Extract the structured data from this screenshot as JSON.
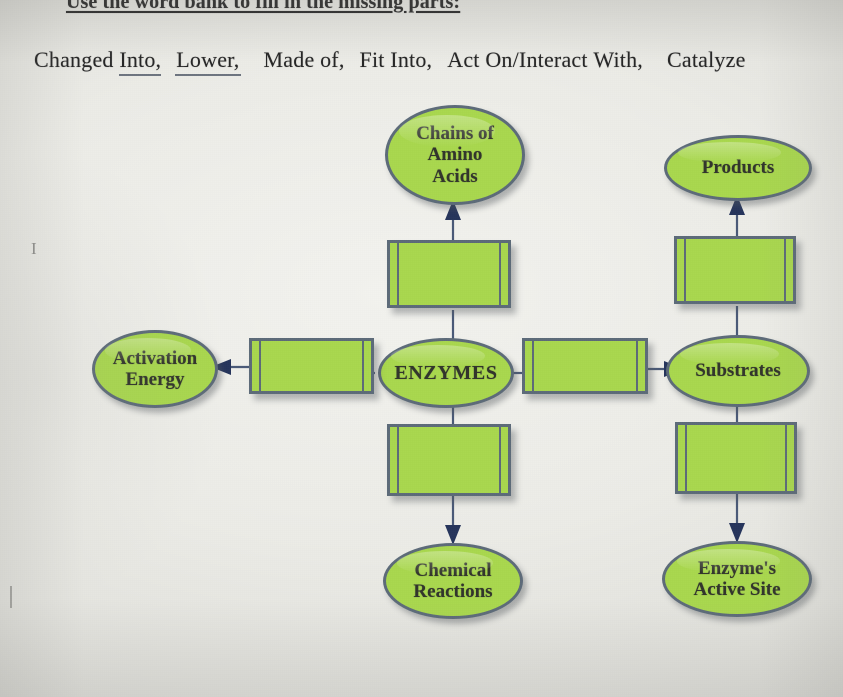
{
  "worksheet": {
    "instruction": "Use the word bank to fill in the missing parts:",
    "word_bank_label": "word bank",
    "words": [
      {
        "text": "Changed Into,",
        "underlined_part": "Into,"
      },
      {
        "text": "Lower,"
      },
      {
        "text": "Made of,"
      },
      {
        "text": "Fit Into,"
      },
      {
        "text": "Act On/Interact With,"
      },
      {
        "text": "Catalyze"
      }
    ],
    "word_bank_line": "Changed Into,  Lower,   Made of,   Fit Into,   Act On/Interact With,    Catalyze"
  },
  "diagram": {
    "type": "concept-map",
    "center": {
      "label": "ENZYMES"
    },
    "nodes": [
      {
        "id": "chains-of-amino-acids",
        "label": "Chains of\nAmino\nAcids",
        "lines": [
          "Chains of",
          "Amino",
          "Acids"
        ],
        "shape": "oval"
      },
      {
        "id": "products",
        "label": "Products",
        "lines": [
          "Products"
        ],
        "shape": "oval"
      },
      {
        "id": "activation-energy",
        "label": "Activation\nEnergy",
        "lines": [
          "Activation",
          "Energy"
        ],
        "shape": "oval"
      },
      {
        "id": "substrates",
        "label": "Substrates",
        "lines": [
          "Substrates"
        ],
        "shape": "oval"
      },
      {
        "id": "chemical-reactions",
        "label": "Chemical\nReactions",
        "lines": [
          "Chemical",
          "Reactions"
        ],
        "shape": "oval"
      },
      {
        "id": "enzymes-active-site",
        "label": "Enzyme's\nActive Site",
        "lines": [
          "Enzyme's",
          "Active Site"
        ],
        "shape": "oval"
      }
    ],
    "blanks": [
      {
        "id": "blank-top-center",
        "value": "",
        "connects": "ENZYMES -> Chains of Amino Acids"
      },
      {
        "id": "blank-top-right",
        "value": "",
        "connects": "Substrates -> Products"
      },
      {
        "id": "blank-left",
        "value": "",
        "connects": "ENZYMES -> Activation Energy"
      },
      {
        "id": "blank-right",
        "value": "",
        "connects": "ENZYMES -> Substrates"
      },
      {
        "id": "blank-bottom-center",
        "value": "",
        "connects": "ENZYMES -> Chemical Reactions"
      },
      {
        "id": "blank-bottom-right",
        "value": "",
        "connects": "Substrates -> Enzyme's Active Site"
      }
    ],
    "colors": {
      "node_fill": "#a9d84e",
      "node_border": "#5d6b79",
      "arrow": "#2b3a60",
      "text": "#32352c",
      "paper": "#ecece7"
    }
  }
}
